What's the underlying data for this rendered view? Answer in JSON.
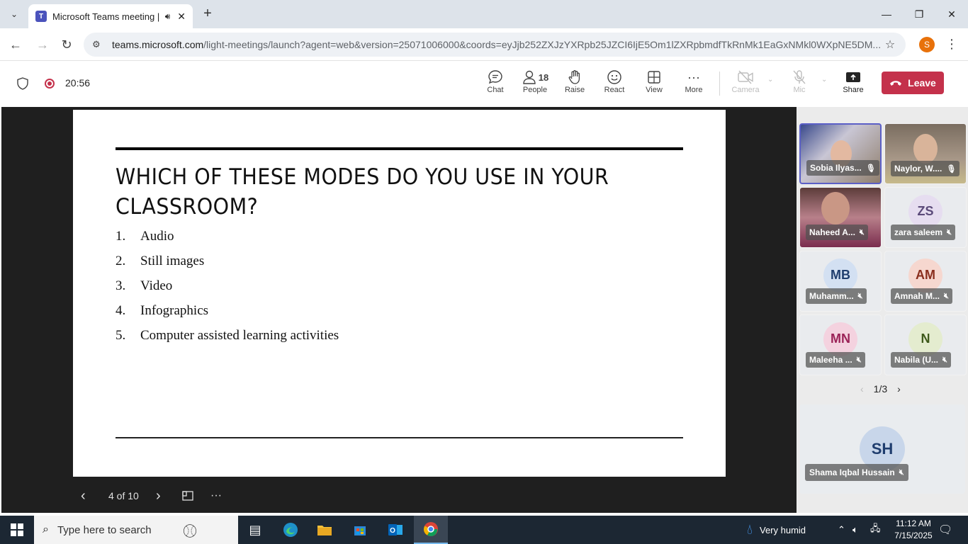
{
  "browser": {
    "tab_title": "Microsoft Teams meeting | Micro",
    "url_host": "teams.microsoft.com",
    "url_path": "/light-meetings/launch?agent=web&version=25071006000&coords=eyJjb252ZXJzYXRpb25JZCI6IjE5Om1lZXRpbmdfTkRnMk1EaGxNMkl0WXpNE5DM...",
    "profile_initial": "S"
  },
  "meeting": {
    "elapsed": "20:56",
    "people_count": "18",
    "toolbar": {
      "chat": "Chat",
      "people": "People",
      "raise": "Raise",
      "react": "React",
      "view": "View",
      "more": "More",
      "camera": "Camera",
      "mic": "Mic",
      "share": "Share",
      "leave": "Leave"
    }
  },
  "slide": {
    "title": "WHICH OF THESE MODES DO YOU USE IN YOUR CLASSROOM?",
    "items": [
      {
        "num": "1.",
        "text": "Audio"
      },
      {
        "num": "2.",
        "text": "Still images"
      },
      {
        "num": "3.",
        "text": "Video"
      },
      {
        "num": "4.",
        "text": "Infographics"
      },
      {
        "num": "5.",
        "text": "Computer assisted learning activities"
      }
    ],
    "counter": "4 of 10"
  },
  "participants": [
    {
      "name": "Sobia Ilyas...",
      "initials": "",
      "video": true
    },
    {
      "name": "Naylor, W....",
      "initials": "",
      "video": true
    },
    {
      "name": "Naheed A...",
      "initials": "",
      "video": true
    },
    {
      "name": "zara saleem",
      "initials": "ZS",
      "video": false,
      "avatar_bg": "#e6ddf0",
      "avatar_fg": "#5b4a7a"
    },
    {
      "name": "Muhamm...",
      "initials": "MB",
      "video": false,
      "avatar_bg": "#d3e0f2",
      "avatar_fg": "#1f3d6e"
    },
    {
      "name": "Amnah M...",
      "initials": "AM",
      "video": false,
      "avatar_bg": "#f6d7cf",
      "avatar_fg": "#8a2e1d"
    },
    {
      "name": "Maleeha ...",
      "initials": "MN",
      "video": false,
      "avatar_bg": "#f4d2df",
      "avatar_fg": "#9b2257"
    },
    {
      "name": "Nabila (U...",
      "initials": "N",
      "video": false,
      "avatar_bg": "#e4eccf",
      "avatar_fg": "#3f5a1c"
    }
  ],
  "gallery_pager": "1/3",
  "featured_participant": {
    "name": "Shama Iqbal Hussain",
    "initials": "SH"
  },
  "taskbar": {
    "search_placeholder": "Type here to search",
    "weather": "Very humid",
    "time": "11:12 AM",
    "date": "7/15/2025"
  },
  "colors": {
    "teams_purple": "#5b5fc7",
    "leave_red": "#c4314b"
  }
}
